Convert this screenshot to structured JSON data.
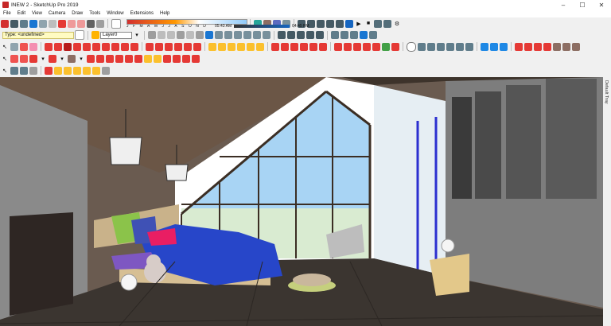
{
  "window": {
    "title": "INEW 2 - SketchUp Pro 2019",
    "minimize": "–",
    "maximize": "☐",
    "close": "✕"
  },
  "menu": [
    "File",
    "Edit",
    "View",
    "Camera",
    "Draw",
    "Tools",
    "Window",
    "Extensions",
    "Help"
  ],
  "shadow": {
    "months": [
      "J",
      "F",
      "M",
      "A",
      "M",
      "J",
      "J",
      "A",
      "S",
      "O",
      "N",
      "D"
    ],
    "time_start": "05:43 AM",
    "time_mid": "Noon",
    "time_end": "04:45 PM"
  },
  "entity": {
    "type_label": "Type: <undefined>",
    "layer_value": "Layer0"
  },
  "tray": {
    "label": "Default Tray"
  },
  "colors": {
    "red_tool": "#d32f2f",
    "blue_tool": "#1976d2",
    "green_tool": "#43a047",
    "yellow_tool": "#fbc02d",
    "blanket": "#2746c9",
    "sky": "#a8d4f4",
    "floor": "#3b3530"
  }
}
